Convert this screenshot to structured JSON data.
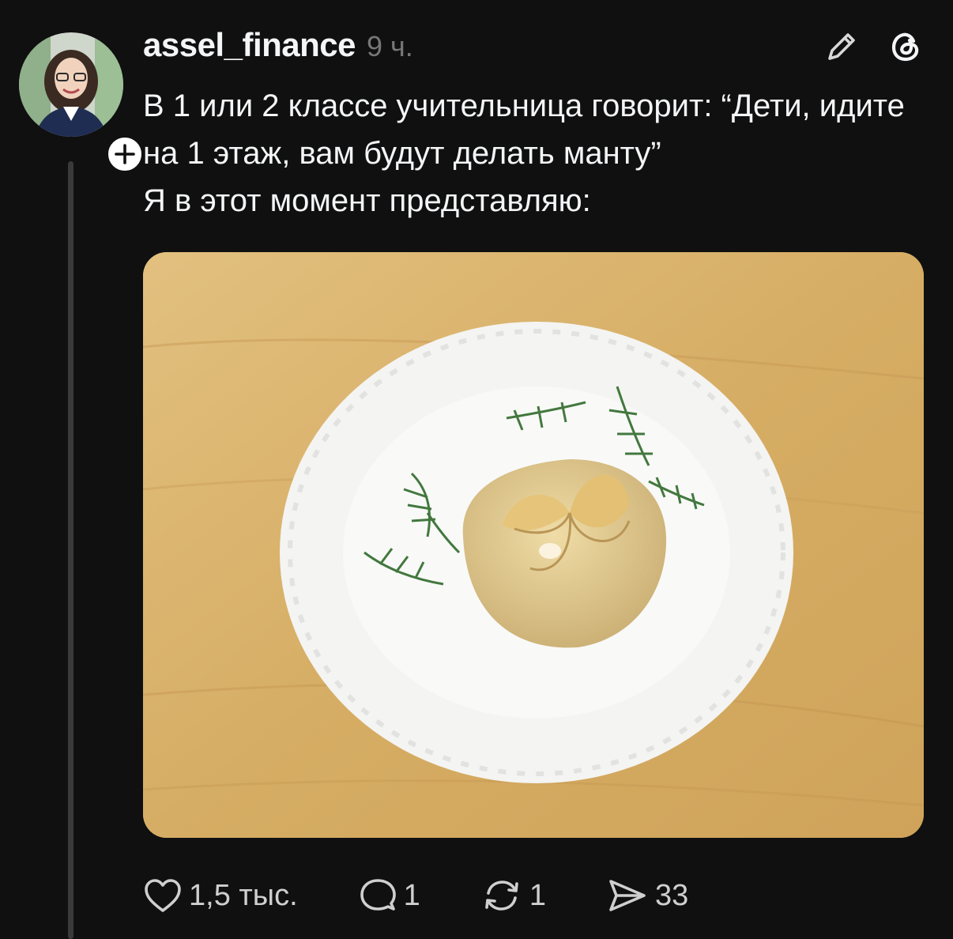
{
  "post": {
    "author": {
      "username": "assel_finance",
      "time": "9 ч.",
      "avatar_icon": "profile-photo"
    },
    "text_lines": [
      "В 1 или 2 классе учительница говорит: “Дети, идите на 1 этаж, вам будут делать манту”",
      "Я в этот момент представляю:"
    ],
    "image": {
      "description_icon": "manti-dumpling-on-plate-photo"
    },
    "actions": {
      "like_count": "1,5 тыс.",
      "comment_count": "1",
      "repost_count": "1",
      "share_count": "33"
    }
  },
  "icons": {
    "edit": "pencil-icon",
    "threads": "threads-logo-icon",
    "follow": "plus-icon"
  },
  "colors": {
    "background": "#101010",
    "text": "#f3f5f7",
    "muted": "#777777",
    "thread_line": "#3a3a3a"
  }
}
